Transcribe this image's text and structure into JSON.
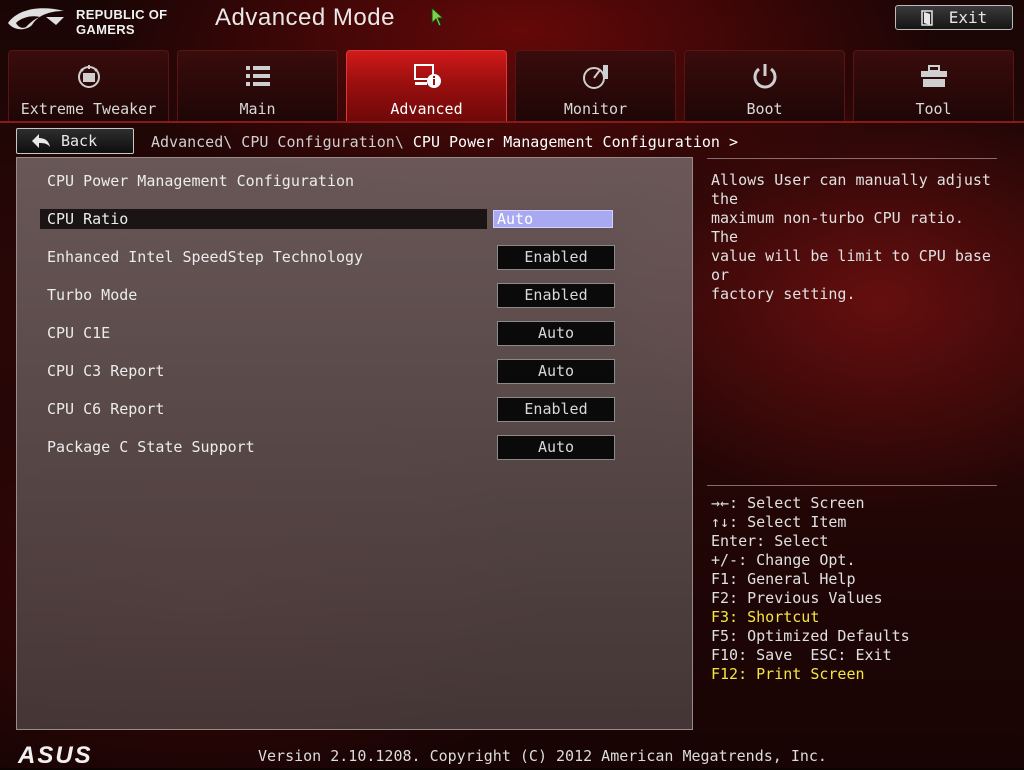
{
  "header": {
    "brand_line1": "REPUBLIC OF",
    "brand_line2": "GAMERS",
    "mode_title": "Advanced Mode",
    "exit_label": "Exit"
  },
  "tabs": [
    {
      "label": "Extreme Tweaker",
      "icon": "tweaker-icon",
      "active": false
    },
    {
      "label": "Main",
      "icon": "list-icon",
      "active": false
    },
    {
      "label": "Advanced",
      "icon": "advanced-info-icon",
      "active": true
    },
    {
      "label": "Monitor",
      "icon": "monitor-gauge-icon",
      "active": false
    },
    {
      "label": "Boot",
      "icon": "power-icon",
      "active": false
    },
    {
      "label": "Tool",
      "icon": "toolbox-icon",
      "active": false
    }
  ],
  "nav": {
    "back_label": "Back",
    "breadcrumb_path": "Advanced\\ CPU Configuration\\ ",
    "breadcrumb_current": "CPU Power Management Configuration >"
  },
  "main": {
    "section_title": "CPU Power Management Configuration",
    "settings": [
      {
        "label": "CPU Ratio",
        "value": "Auto",
        "selected": true
      },
      {
        "label": "Enhanced Intel SpeedStep Technology",
        "value": "Enabled"
      },
      {
        "label": "Turbo Mode",
        "value": "Enabled"
      },
      {
        "label": "CPU C1E",
        "value": "Auto"
      },
      {
        "label": "CPU C3 Report",
        "value": "Auto"
      },
      {
        "label": "CPU C6 Report",
        "value": "Enabled"
      },
      {
        "label": "Package C State Support",
        "value": "Auto"
      }
    ]
  },
  "help": {
    "description_lines": [
      "Allows User can manually adjust the",
      "maximum non-turbo CPU ratio. The",
      "value will be limit to CPU base or",
      "factory setting."
    ],
    "keys": [
      {
        "text": "→←: Select Screen",
        "highlight": false
      },
      {
        "text": "↑↓: Select Item",
        "highlight": false
      },
      {
        "text": "Enter: Select",
        "highlight": false
      },
      {
        "text": "+/-: Change Opt.",
        "highlight": false
      },
      {
        "text": "F1: General Help",
        "highlight": false
      },
      {
        "text": "F2: Previous Values",
        "highlight": false
      },
      {
        "text": "F3: Shortcut",
        "highlight": true
      },
      {
        "text": "F5: Optimized Defaults",
        "highlight": false
      },
      {
        "text": "F10: Save  ESC: Exit",
        "highlight": false
      },
      {
        "text": "F12: Print Screen",
        "highlight": true
      }
    ]
  },
  "footer": {
    "asus_logo": "ASUS",
    "version_text": "Version 2.10.1208. Copyright (C) 2012 American Megatrends, Inc."
  },
  "colors": {
    "active_tab": "#c81414",
    "selected_value_bg": "#a9a9f2",
    "key_highlight": "#f5e641"
  }
}
